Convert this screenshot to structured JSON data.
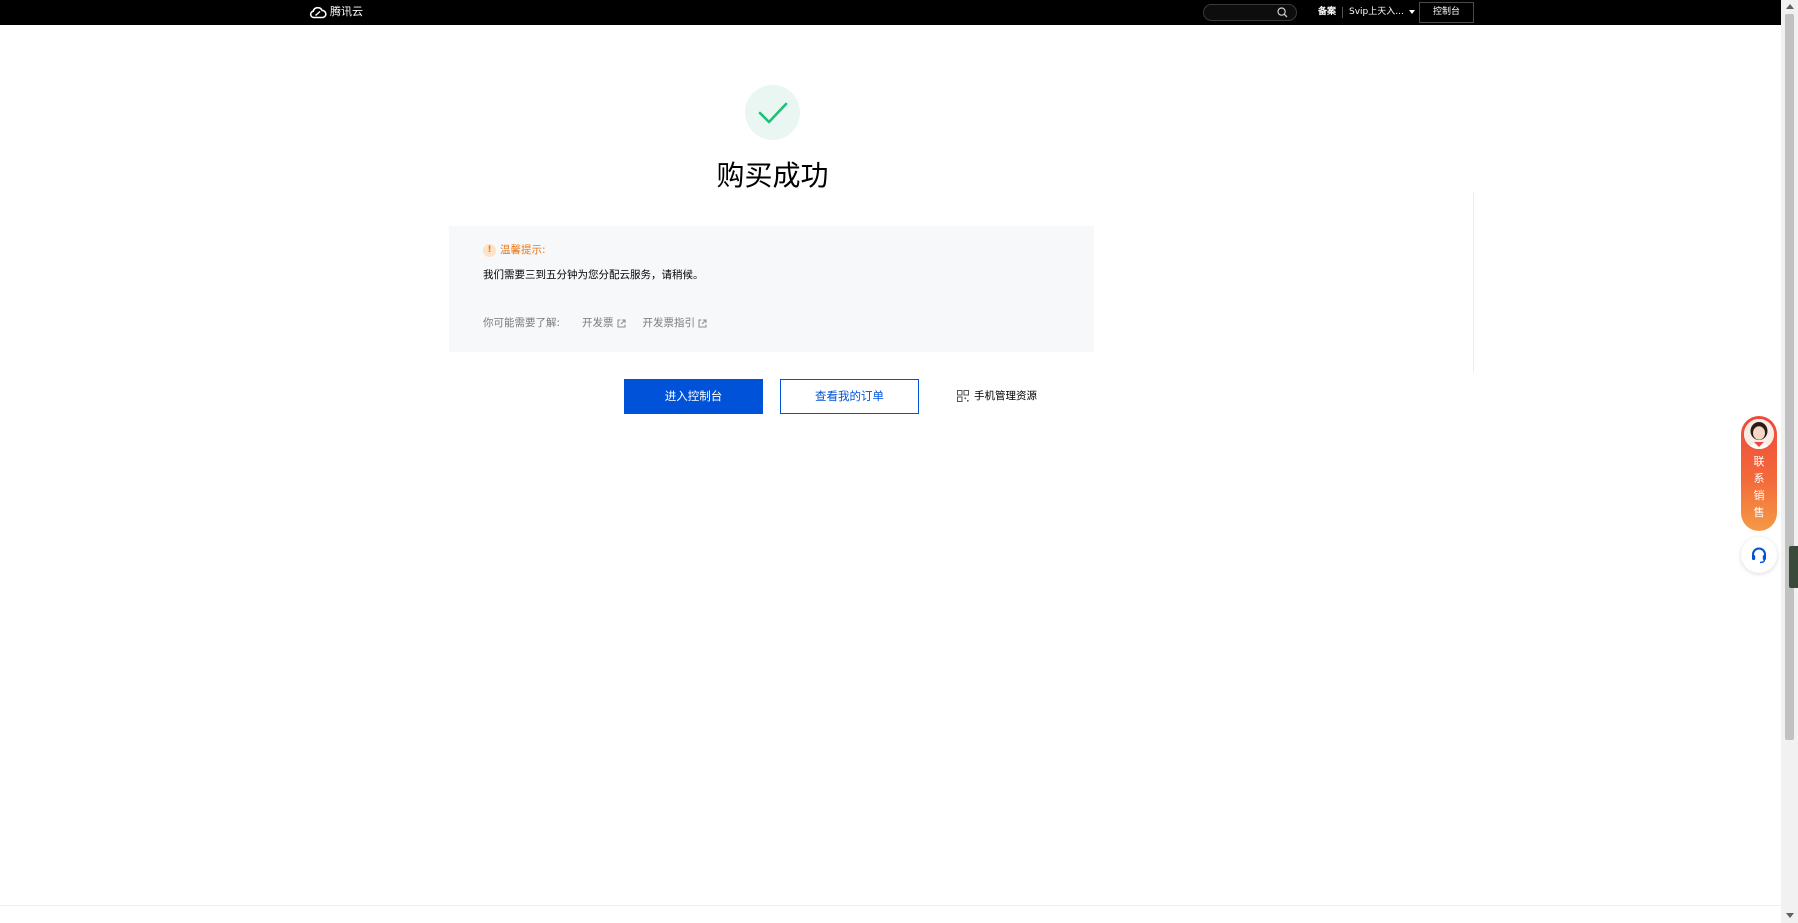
{
  "header": {
    "logo_text": "腾讯云",
    "search_placeholder": "",
    "beian": "备案",
    "user_name": "Svip上天入...",
    "console_label": "控制台"
  },
  "result": {
    "icon": "check-icon",
    "title": "购买成功"
  },
  "notice": {
    "heading": "温馨提示:",
    "message": "我们需要三到五分钟为您分配云服务，请稍候。",
    "links_label": "你可能需要了解:",
    "links": [
      "开发票",
      "开发票指引"
    ]
  },
  "actions": {
    "primary": "进入控制台",
    "secondary": "查看我的订单",
    "mobile": "手机管理资源"
  },
  "float_widget": {
    "sales_label": [
      "联",
      "系",
      "销",
      "售"
    ]
  },
  "colors": {
    "primary": "#0052d9",
    "success": "#1ec07a",
    "warning": "#e87a1e",
    "sales_gradient_top": "#f0483a",
    "sales_gradient_bottom": "#f59a45"
  }
}
